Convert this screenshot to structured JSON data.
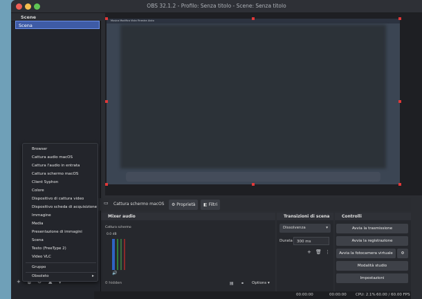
{
  "window": {
    "title": "OBS 32.1.2 - Profilo: Senza titolo - Scene: Senza titolo"
  },
  "scenes": {
    "header": "Scene",
    "items": [
      "Scena"
    ]
  },
  "sources_menu": {
    "items": [
      "Browser",
      "Cattura audio macOS",
      "Cattura l'audio in entrata",
      "Cattura schermo macOS",
      "Client Syphon",
      "Colore",
      "Dispositivo di cattura video",
      "Dispositivo scheda di acquisizione",
      "Immagine",
      "Media",
      "Presentazione di immagini",
      "Scena",
      "Testo (FreeType 2)",
      "Video VLC"
    ],
    "group": "Gruppo",
    "deprecated": "Obsoleto"
  },
  "preview": {
    "menubar": "Musica Modifica Vista Finestra Aiuto"
  },
  "source_toolbar": {
    "source": "Cattura schermo macOS",
    "properties": "Proprietà",
    "filters": "Filtri"
  },
  "mixer": {
    "header": "Mixer audio",
    "hidden": "0 hidden",
    "channel": "Cattura schermo",
    "level": "0.0 dB",
    "options": "Options"
  },
  "transitions": {
    "header": "Transizioni di scena",
    "selected": "Dissolvenza",
    "duration_label": "Durata",
    "duration_value": "300 ms"
  },
  "controls": {
    "header": "Controlli",
    "start_stream": "Avvia la trasmissione",
    "start_record": "Avvia la registrazione",
    "virtual_cam": "Avvia la fotocamera virtuale",
    "studio_mode": "Modalità studio",
    "settings": "Impostazioni"
  },
  "status": {
    "time1": "00:00:00",
    "time2": "00:00:00",
    "cpu": "CPU: 2.1%",
    "fps": "60.00 / 60.00 FPS"
  },
  "colors": {
    "accent": "#3e5ba6",
    "handle": "#e13838"
  }
}
